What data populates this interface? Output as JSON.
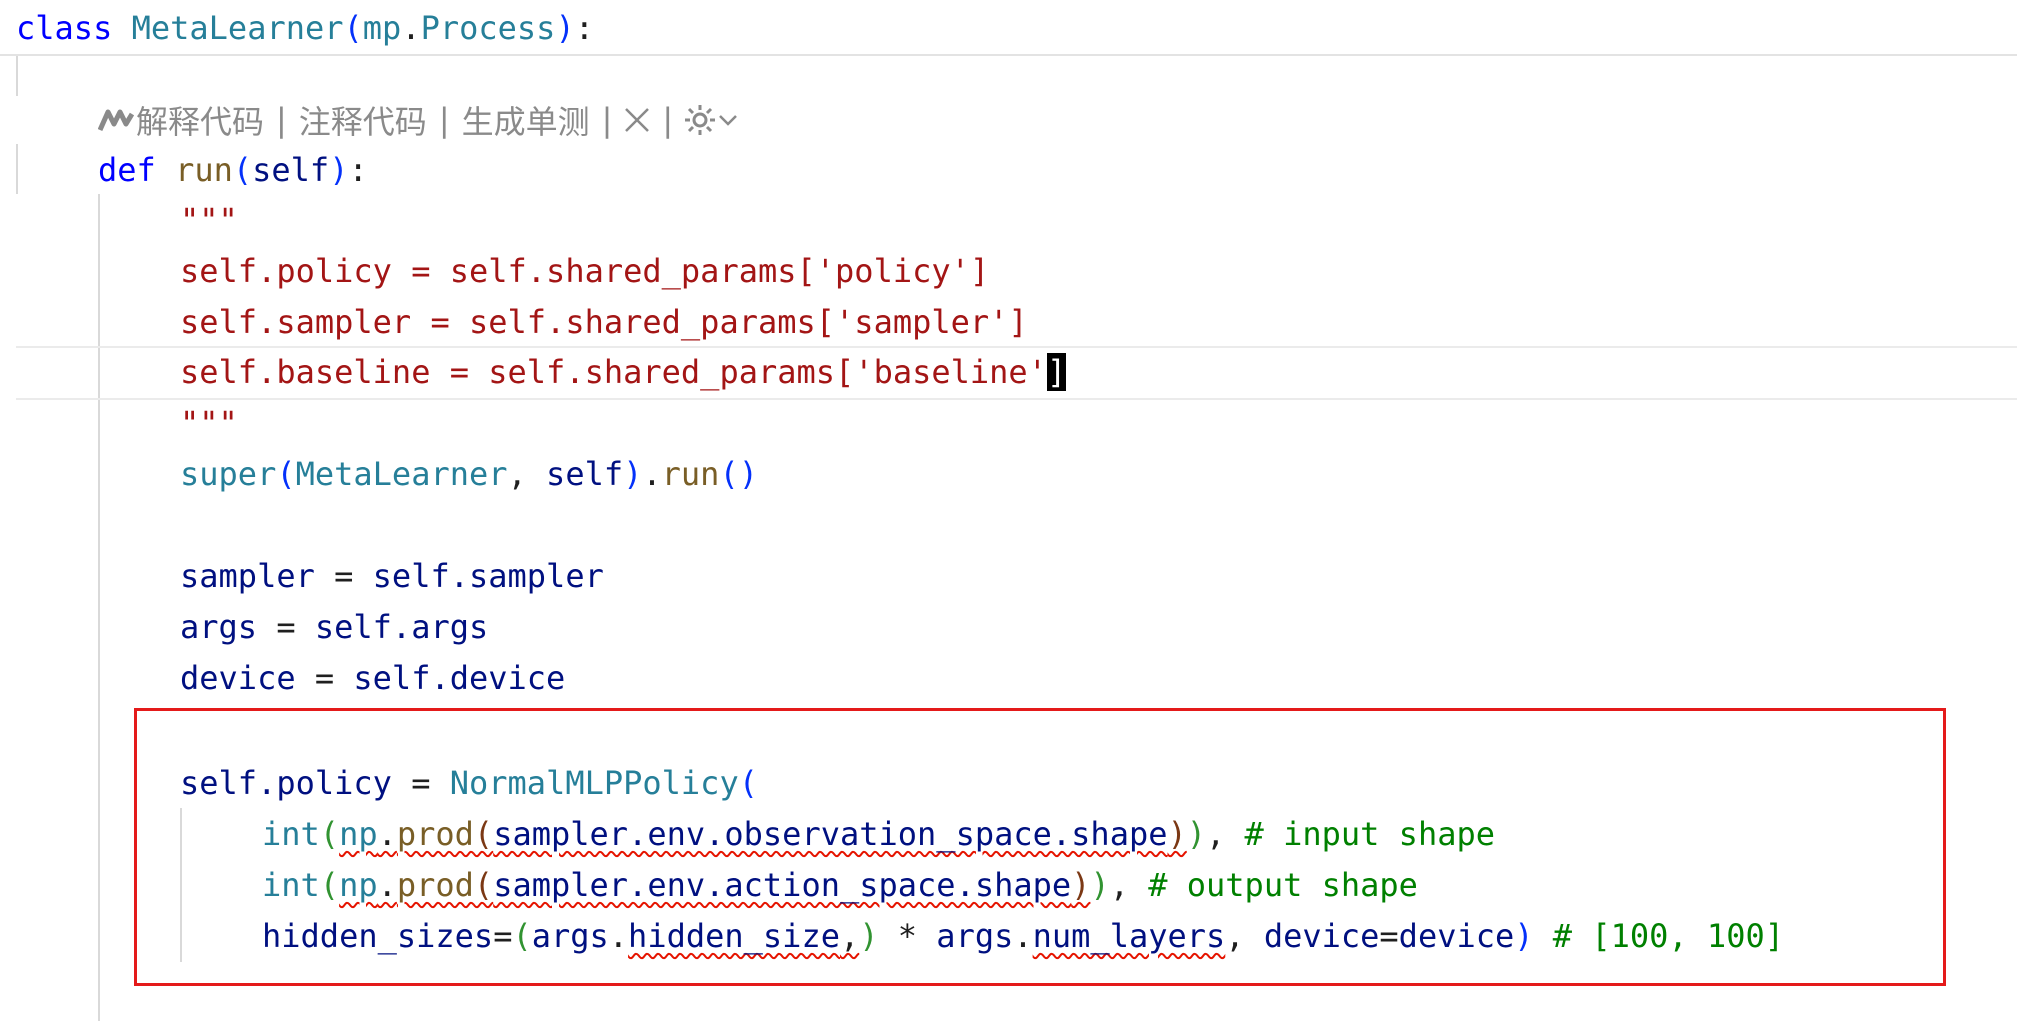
{
  "sticky_header": {
    "class_kw": "class",
    "class_name": "MetaLearner",
    "paren_open": "(",
    "base_mod": "mp",
    "dot": ".",
    "base_cls": "Process",
    "paren_close": ")",
    "colon": ":"
  },
  "codelens": {
    "explain": "解释代码",
    "comment": "注释代码",
    "unit_test": "生成单测",
    "sep": "|",
    "icons": [
      "marscode-logo-icon",
      "close-icon",
      "settings-gear-icon",
      "chevron-down-icon"
    ]
  },
  "code": {
    "l1": {
      "kw": "def",
      "fn": "run",
      "po": "(",
      "self": "self",
      "pc": ")",
      "colon": ":"
    },
    "l2": {
      "text": "\"\"\""
    },
    "l3": {
      "text": "self.policy = self.shared_params['policy']"
    },
    "l4": {
      "text": "self.sampler = self.shared_params['sampler']"
    },
    "l5": {
      "text": "self.baseline = self.shared_params['baseline'",
      "cursor_char": "]"
    },
    "l6": {
      "text": "\"\"\""
    },
    "l7": {
      "super": "super",
      "po": "(",
      "cls": "MetaLearner",
      "comma": ", ",
      "self": "self",
      "pc": ")",
      "dot": ".",
      "run": "run",
      "call": "()"
    },
    "l9": {
      "var": "sampler",
      "eq": " = ",
      "rhs": "self.sampler"
    },
    "l10": {
      "var": "args",
      "eq": " = ",
      "rhs": "self.args"
    },
    "l11": {
      "var": "device",
      "eq": " = ",
      "rhs": "self.device"
    },
    "l13": {
      "lhs": "self.policy",
      "eq": " = ",
      "cls": "NormalMLPPolicy",
      "po": "("
    },
    "l14": {
      "int": "int",
      "p1": "(",
      "np": "np",
      "dot": ".",
      "prod": "prod",
      "p2": "(",
      "arg": "sampler.env.observation_space.shape",
      "p2c": ")",
      "p1c": ")",
      "tail": ", ",
      "comment": "# input shape"
    },
    "l15": {
      "int": "int",
      "p1": "(",
      "np": "np",
      "dot": ".",
      "prod": "prod",
      "p2": "(",
      "arg": "sampler.env.action_space.shape",
      "p2c": ")",
      "p1c": ")",
      "tail": ", ",
      "comment": "# output shape"
    },
    "l16": {
      "kw": "hidden_sizes",
      "eq": "=",
      "po": "(",
      "a": "args",
      "dot": ".",
      "hs": "hidden_size",
      "comma": ",",
      "pc": ")",
      "mul": " * ",
      "a2": "args",
      "dot2": ".",
      "nl": "num_layers",
      "sep": ", ",
      "dev": "device",
      "eq2": "=",
      "dev2": "device",
      "close": ")",
      "sp": " ",
      "comment": "# [100, 100]"
    }
  },
  "colors": {
    "keyword": "#0000ff",
    "class": "#267f99",
    "function": "#795e26",
    "string": "#a31515",
    "variable": "#001080",
    "comment": "#008000",
    "highlight_box": "#e41a1a"
  }
}
